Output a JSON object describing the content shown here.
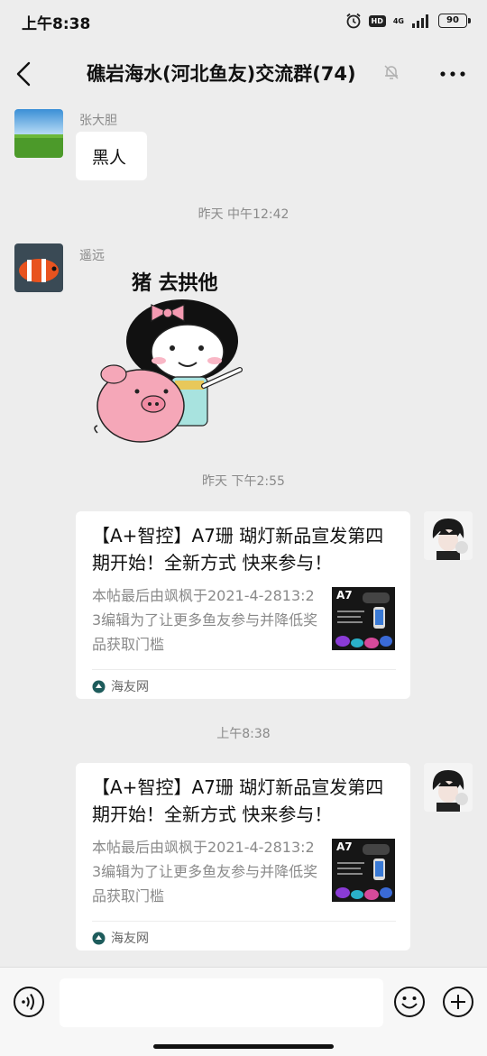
{
  "status_bar": {
    "time": "上午8:38",
    "hd": "HD",
    "network": "4G",
    "battery": "90"
  },
  "nav": {
    "title": "礁岩海水(河北鱼友)交流群(74)"
  },
  "messages": [
    {
      "sender": "张大胆",
      "text": "黑人"
    },
    {
      "timestamp": "昨天 中午12:42"
    },
    {
      "sender": "遥远",
      "sticker_caption": "猪 去拱他"
    },
    {
      "timestamp": "昨天 下午2:55"
    },
    {
      "title": "【A+智控】A7珊 瑚灯新品宣发第四期开始！全新方式  快来参与！",
      "desc": "本帖最后由飒枫于2021-4-2813:23编辑为了让更多鱼友参与并降低奖品获取门槛",
      "thumb_label": "A7",
      "source": "海友网"
    },
    {
      "timestamp": "上午8:38"
    },
    {
      "title": "【A+智控】A7珊 瑚灯新品宣发第四期开始！全新方式  快来参与！",
      "desc": "本帖最后由飒枫于2021-4-2813:23编辑为了让更多鱼友参与并降低奖品获取门槛",
      "thumb_label": "A7",
      "source": "海友网"
    }
  ],
  "colors": {
    "background": "#ededed",
    "bubble": "#ffffff",
    "meta_text": "#8a8a8a"
  }
}
